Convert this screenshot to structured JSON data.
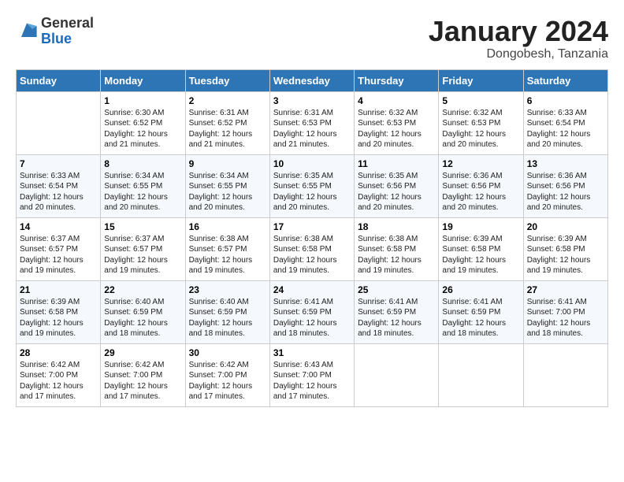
{
  "logo": {
    "general": "General",
    "blue": "Blue"
  },
  "title": "January 2024",
  "location": "Dongobesh, Tanzania",
  "days_header": [
    "Sunday",
    "Monday",
    "Tuesday",
    "Wednesday",
    "Thursday",
    "Friday",
    "Saturday"
  ],
  "weeks": [
    [
      {
        "num": "",
        "info": ""
      },
      {
        "num": "1",
        "info": "Sunrise: 6:30 AM\nSunset: 6:52 PM\nDaylight: 12 hours\nand 21 minutes."
      },
      {
        "num": "2",
        "info": "Sunrise: 6:31 AM\nSunset: 6:52 PM\nDaylight: 12 hours\nand 21 minutes."
      },
      {
        "num": "3",
        "info": "Sunrise: 6:31 AM\nSunset: 6:53 PM\nDaylight: 12 hours\nand 21 minutes."
      },
      {
        "num": "4",
        "info": "Sunrise: 6:32 AM\nSunset: 6:53 PM\nDaylight: 12 hours\nand 20 minutes."
      },
      {
        "num": "5",
        "info": "Sunrise: 6:32 AM\nSunset: 6:53 PM\nDaylight: 12 hours\nand 20 minutes."
      },
      {
        "num": "6",
        "info": "Sunrise: 6:33 AM\nSunset: 6:54 PM\nDaylight: 12 hours\nand 20 minutes."
      }
    ],
    [
      {
        "num": "7",
        "info": "Sunrise: 6:33 AM\nSunset: 6:54 PM\nDaylight: 12 hours\nand 20 minutes."
      },
      {
        "num": "8",
        "info": "Sunrise: 6:34 AM\nSunset: 6:55 PM\nDaylight: 12 hours\nand 20 minutes."
      },
      {
        "num": "9",
        "info": "Sunrise: 6:34 AM\nSunset: 6:55 PM\nDaylight: 12 hours\nand 20 minutes."
      },
      {
        "num": "10",
        "info": "Sunrise: 6:35 AM\nSunset: 6:55 PM\nDaylight: 12 hours\nand 20 minutes."
      },
      {
        "num": "11",
        "info": "Sunrise: 6:35 AM\nSunset: 6:56 PM\nDaylight: 12 hours\nand 20 minutes."
      },
      {
        "num": "12",
        "info": "Sunrise: 6:36 AM\nSunset: 6:56 PM\nDaylight: 12 hours\nand 20 minutes."
      },
      {
        "num": "13",
        "info": "Sunrise: 6:36 AM\nSunset: 6:56 PM\nDaylight: 12 hours\nand 20 minutes."
      }
    ],
    [
      {
        "num": "14",
        "info": "Sunrise: 6:37 AM\nSunset: 6:57 PM\nDaylight: 12 hours\nand 19 minutes."
      },
      {
        "num": "15",
        "info": "Sunrise: 6:37 AM\nSunset: 6:57 PM\nDaylight: 12 hours\nand 19 minutes."
      },
      {
        "num": "16",
        "info": "Sunrise: 6:38 AM\nSunset: 6:57 PM\nDaylight: 12 hours\nand 19 minutes."
      },
      {
        "num": "17",
        "info": "Sunrise: 6:38 AM\nSunset: 6:58 PM\nDaylight: 12 hours\nand 19 minutes."
      },
      {
        "num": "18",
        "info": "Sunrise: 6:38 AM\nSunset: 6:58 PM\nDaylight: 12 hours\nand 19 minutes."
      },
      {
        "num": "19",
        "info": "Sunrise: 6:39 AM\nSunset: 6:58 PM\nDaylight: 12 hours\nand 19 minutes."
      },
      {
        "num": "20",
        "info": "Sunrise: 6:39 AM\nSunset: 6:58 PM\nDaylight: 12 hours\nand 19 minutes."
      }
    ],
    [
      {
        "num": "21",
        "info": "Sunrise: 6:39 AM\nSunset: 6:58 PM\nDaylight: 12 hours\nand 19 minutes."
      },
      {
        "num": "22",
        "info": "Sunrise: 6:40 AM\nSunset: 6:59 PM\nDaylight: 12 hours\nand 18 minutes."
      },
      {
        "num": "23",
        "info": "Sunrise: 6:40 AM\nSunset: 6:59 PM\nDaylight: 12 hours\nand 18 minutes."
      },
      {
        "num": "24",
        "info": "Sunrise: 6:41 AM\nSunset: 6:59 PM\nDaylight: 12 hours\nand 18 minutes."
      },
      {
        "num": "25",
        "info": "Sunrise: 6:41 AM\nSunset: 6:59 PM\nDaylight: 12 hours\nand 18 minutes."
      },
      {
        "num": "26",
        "info": "Sunrise: 6:41 AM\nSunset: 6:59 PM\nDaylight: 12 hours\nand 18 minutes."
      },
      {
        "num": "27",
        "info": "Sunrise: 6:41 AM\nSunset: 7:00 PM\nDaylight: 12 hours\nand 18 minutes."
      }
    ],
    [
      {
        "num": "28",
        "info": "Sunrise: 6:42 AM\nSunset: 7:00 PM\nDaylight: 12 hours\nand 17 minutes."
      },
      {
        "num": "29",
        "info": "Sunrise: 6:42 AM\nSunset: 7:00 PM\nDaylight: 12 hours\nand 17 minutes."
      },
      {
        "num": "30",
        "info": "Sunrise: 6:42 AM\nSunset: 7:00 PM\nDaylight: 12 hours\nand 17 minutes."
      },
      {
        "num": "31",
        "info": "Sunrise: 6:43 AM\nSunset: 7:00 PM\nDaylight: 12 hours\nand 17 minutes."
      },
      {
        "num": "",
        "info": ""
      },
      {
        "num": "",
        "info": ""
      },
      {
        "num": "",
        "info": ""
      }
    ]
  ]
}
